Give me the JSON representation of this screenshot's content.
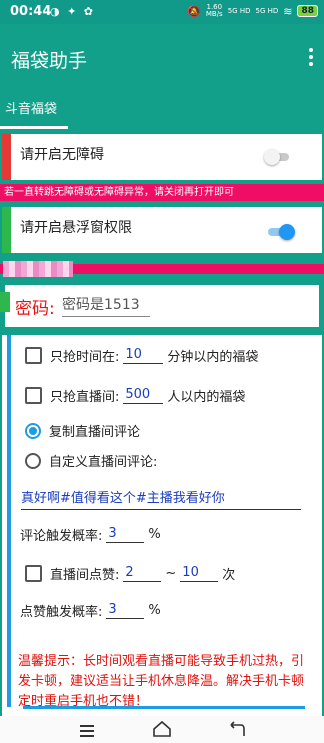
{
  "status_bar": {
    "time": "00:44",
    "net_speed_value": "1.60",
    "net_speed_unit": "MB/s",
    "signal_1": "5G HD",
    "signal_2": "5G HD",
    "battery": "88"
  },
  "app": {
    "title": "福袋助手"
  },
  "tabs": [
    {
      "label": "斗音福袋",
      "active": true
    }
  ],
  "accessibility": {
    "label": "请开启无障碍",
    "enabled": false,
    "bar_color": "#e53935"
  },
  "warning_banner": "若一直转跳无障碍或无障碍异常，请关闭再打开即可",
  "overlay_permission": {
    "label": "请开启悬浮窗权限",
    "enabled": true,
    "bar_color": "#2eb84b"
  },
  "password": {
    "label": "密码:",
    "placeholder": "密码是1513"
  },
  "options": {
    "time_limit": {
      "checked": false,
      "prefix": "只抢时间在:",
      "value": "10",
      "suffix": "分钟以内的福袋"
    },
    "viewer_limit": {
      "checked": false,
      "prefix": "只抢直播间:",
      "value": "500",
      "suffix": "人以内的福袋"
    },
    "copy_comment": {
      "selected": true,
      "label": "复制直播间评论"
    },
    "custom_comment": {
      "selected": false,
      "label": "自定义直播间评论:"
    },
    "custom_comment_text": "真好啊#值得看这个#主播我看好你",
    "comment_probability": {
      "label": "评论触发概率:",
      "value": "3",
      "unit": "%"
    },
    "like": {
      "checked": false,
      "label": "直播间点赞:",
      "min": "2",
      "separator": "~",
      "max": "10",
      "unit": "次"
    },
    "like_probability": {
      "label": "点赞触发概率:",
      "value": "3",
      "unit": "%"
    }
  },
  "tip": "温馨提示：长时间观看直播可能导致手机过热，引发卡顿，建议适当让手机休息降温。解决手机卡顿定时重启手机也不错！",
  "colors": {
    "primary": "#13a08a",
    "accent": "#1f9ae5",
    "banner": "#ee0e63",
    "tip_text": "#e0120e"
  }
}
